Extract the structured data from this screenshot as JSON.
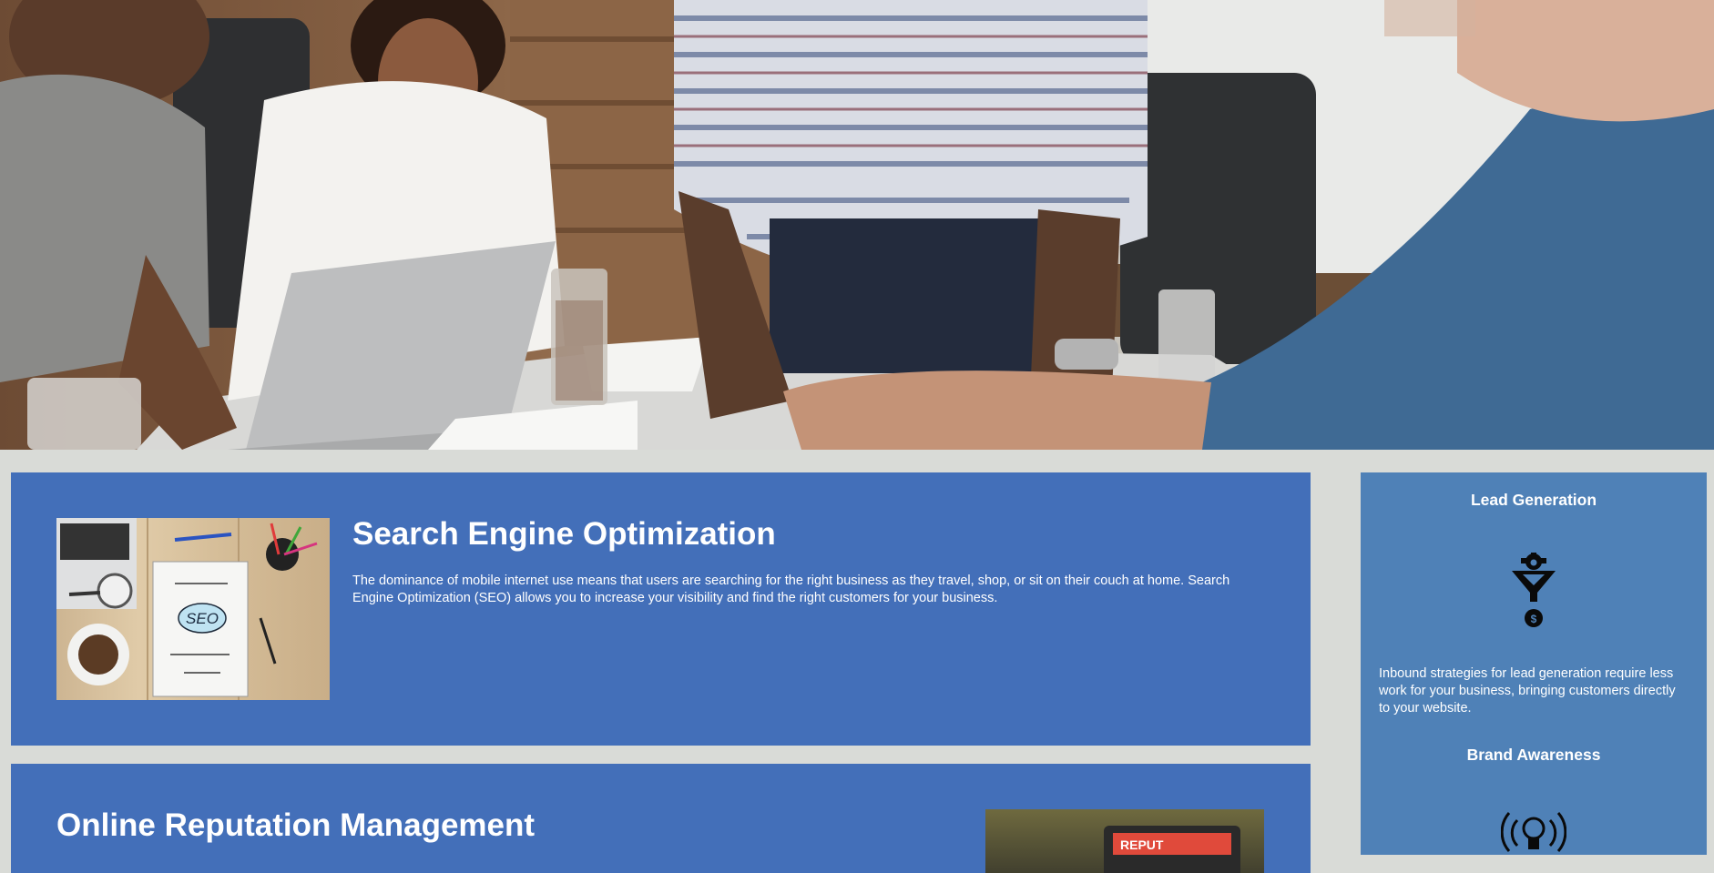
{
  "hero": {
    "icon": "team-meeting-photo"
  },
  "services": [
    {
      "title": "Search Engine Optimization",
      "description": "The dominance of mobile internet use means that users are searching for the right business as they travel, shop, or sit on their couch at home. Search Engine Optimization (SEO) allows you to increase your visibility and find the right customers for your business.",
      "image": {
        "icon": "seo-notebook-photo",
        "label": "SEO"
      }
    },
    {
      "title": "Online Reputation Management",
      "image": {
        "icon": "reputation-tablet-photo",
        "label": "REPUT"
      }
    }
  ],
  "benefits": [
    {
      "title": "Lead Generation",
      "icon": "funnel-gear-dollar-icon",
      "description": "Inbound strategies for lead generation require less work for your business, bringing customers directly to your website."
    },
    {
      "title": "Brand Awareness",
      "icon": "lightbulb-broadcast-icon"
    }
  ],
  "colors": {
    "page_background": "#d9dbd7",
    "card_blue": "#436fb9",
    "sidebar_blue": "#4f81b7",
    "text": "#ffffff"
  }
}
